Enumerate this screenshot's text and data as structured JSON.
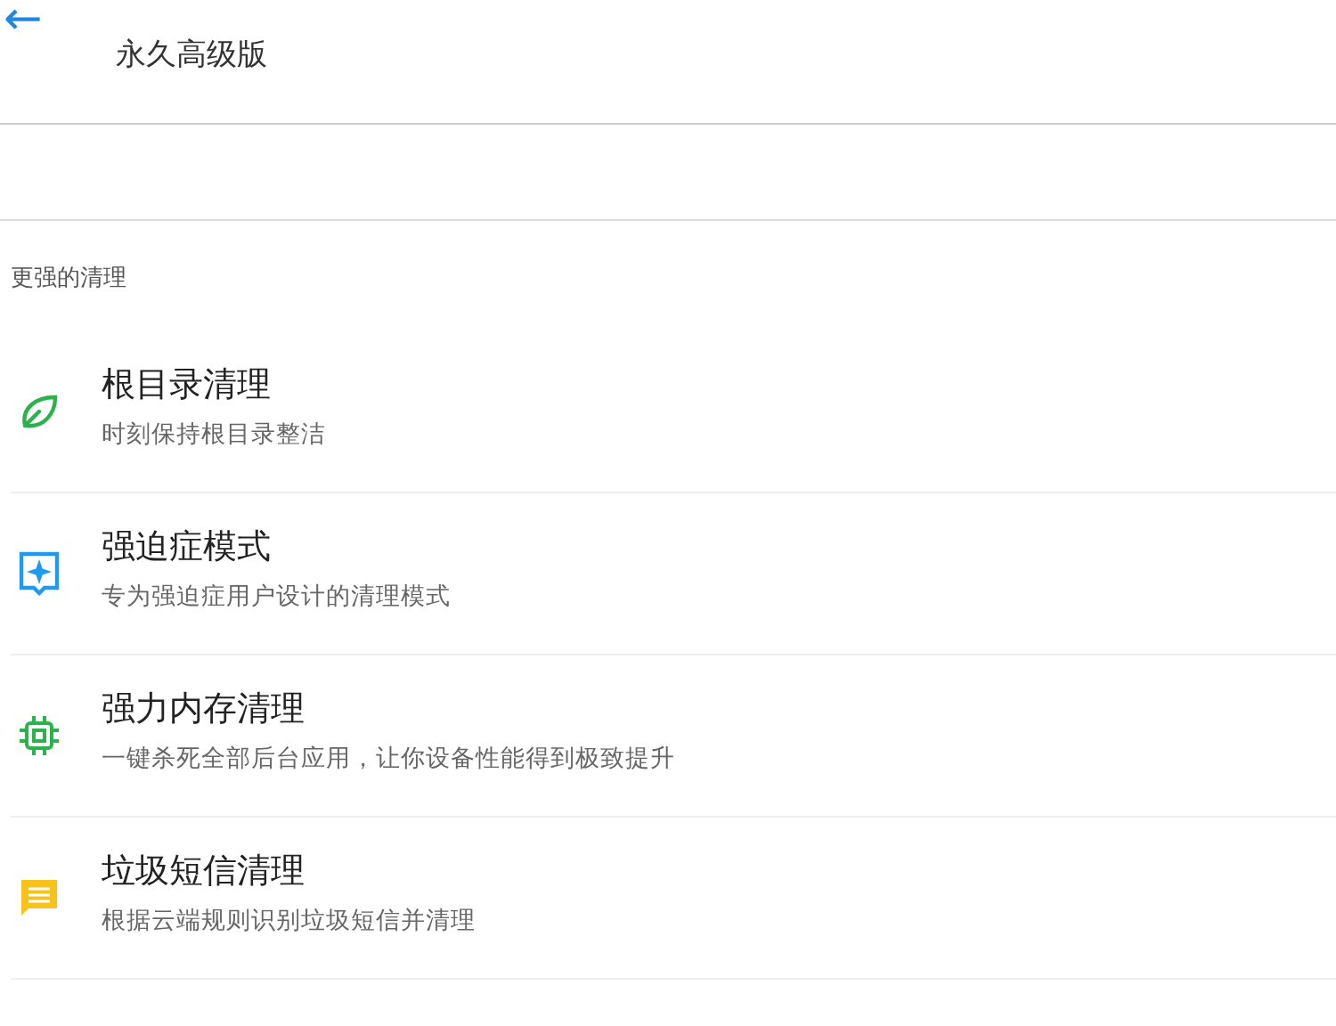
{
  "header": {
    "back": "←",
    "title": "永久高级版"
  },
  "section": {
    "label": "更强的清理"
  },
  "items": [
    {
      "kind": "leaf",
      "color": "#2bb24c",
      "title": "根目录清理",
      "subtitle": "时刻保持根目录整洁"
    },
    {
      "kind": "badge",
      "color": "#1e9bf0",
      "title": "强迫症模式",
      "subtitle": "专为强迫症用户设计的清理模式"
    },
    {
      "kind": "chip",
      "color": "#2bb24c",
      "title": "强力内存清理",
      "subtitle": "一键杀死全部后台应用，让你设备性能得到极致提升"
    },
    {
      "kind": "message",
      "color": "#f7c21b",
      "title": "垃圾短信清理",
      "subtitle": "根据云端规则识别垃圾短信并清理"
    }
  ]
}
